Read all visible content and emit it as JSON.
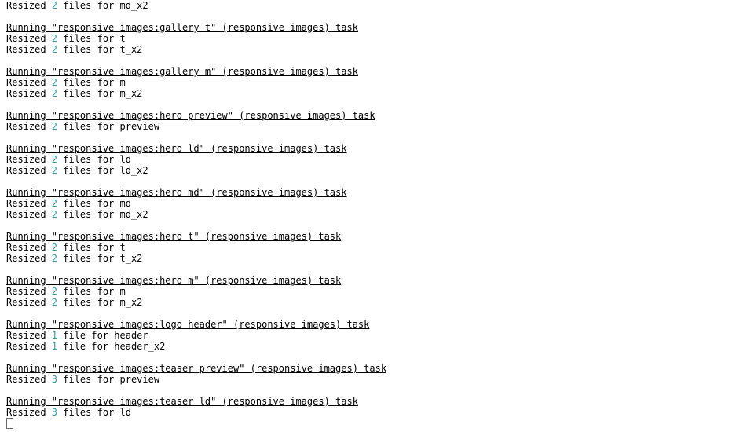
{
  "colors": {
    "accent_number": "#2aa1b3",
    "text": "#000000",
    "background": "#ffffff"
  },
  "lines": [
    {
      "type": "resized",
      "pre": "Resized ",
      "count": "2",
      "post": " files for md_x2"
    },
    {
      "type": "blank"
    },
    {
      "type": "task",
      "text": "Running \"responsive images:gallery t\" (responsive images) task"
    },
    {
      "type": "resized",
      "pre": "Resized ",
      "count": "2",
      "post": " files for t"
    },
    {
      "type": "resized",
      "pre": "Resized ",
      "count": "2",
      "post": " files for t_x2"
    },
    {
      "type": "blank"
    },
    {
      "type": "task",
      "text": "Running \"responsive images:gallery m\" (responsive images) task"
    },
    {
      "type": "resized",
      "pre": "Resized ",
      "count": "2",
      "post": " files for m"
    },
    {
      "type": "resized",
      "pre": "Resized ",
      "count": "2",
      "post": " files for m_x2"
    },
    {
      "type": "blank"
    },
    {
      "type": "task",
      "text": "Running \"responsive images:hero preview\" (responsive images) task"
    },
    {
      "type": "resized",
      "pre": "Resized ",
      "count": "2",
      "post": " files for preview"
    },
    {
      "type": "blank"
    },
    {
      "type": "task",
      "text": "Running \"responsive images:hero ld\" (responsive images) task"
    },
    {
      "type": "resized",
      "pre": "Resized ",
      "count": "2",
      "post": " files for ld"
    },
    {
      "type": "resized",
      "pre": "Resized ",
      "count": "2",
      "post": " files for ld_x2"
    },
    {
      "type": "blank"
    },
    {
      "type": "task",
      "text": "Running \"responsive images:hero md\" (responsive images) task"
    },
    {
      "type": "resized",
      "pre": "Resized ",
      "count": "2",
      "post": " files for md"
    },
    {
      "type": "resized",
      "pre": "Resized ",
      "count": "2",
      "post": " files for md_x2"
    },
    {
      "type": "blank"
    },
    {
      "type": "task",
      "text": "Running \"responsive images:hero t\" (responsive images) task"
    },
    {
      "type": "resized",
      "pre": "Resized ",
      "count": "2",
      "post": " files for t"
    },
    {
      "type": "resized",
      "pre": "Resized ",
      "count": "2",
      "post": " files for t_x2"
    },
    {
      "type": "blank"
    },
    {
      "type": "task",
      "text": "Running \"responsive images:hero m\" (responsive images) task"
    },
    {
      "type": "resized",
      "pre": "Resized ",
      "count": "2",
      "post": " files for m"
    },
    {
      "type": "resized",
      "pre": "Resized ",
      "count": "2",
      "post": " files for m_x2"
    },
    {
      "type": "blank"
    },
    {
      "type": "task",
      "text": "Running \"responsive images:logo header\" (responsive images) task"
    },
    {
      "type": "resized",
      "pre": "Resized ",
      "count": "1",
      "post": " file for header"
    },
    {
      "type": "resized",
      "pre": "Resized ",
      "count": "1",
      "post": " file for header_x2"
    },
    {
      "type": "blank"
    },
    {
      "type": "task",
      "text": "Running \"responsive images:teaser preview\" (responsive images) task"
    },
    {
      "type": "resized",
      "pre": "Resized ",
      "count": "3",
      "post": " files for preview"
    },
    {
      "type": "blank"
    },
    {
      "type": "task",
      "text": "Running \"responsive images:teaser ld\" (responsive images) task"
    },
    {
      "type": "resized",
      "pre": "Resized ",
      "count": "3",
      "post": " files for ld"
    },
    {
      "type": "cursor"
    }
  ]
}
